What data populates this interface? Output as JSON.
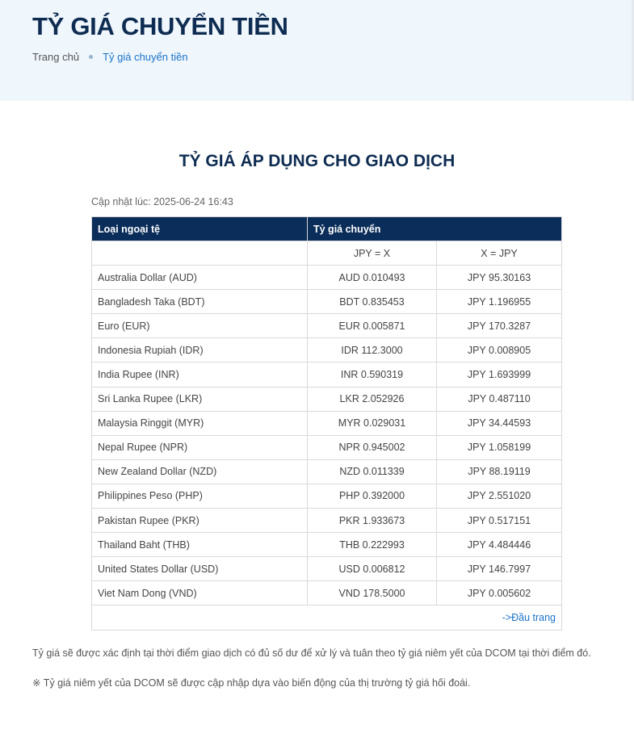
{
  "header": {
    "title": "TỶ GIÁ CHUYỂN TIỀN",
    "breadcrumb": {
      "home": "Trang chủ",
      "current": "Tỷ giá chuyển tiền"
    }
  },
  "main": {
    "section_title": "TỶ GIÁ ÁP DỤNG CHO GIAO DỊCH",
    "updated_text": "Cập nhật lúc: 2025-06-24 16:43",
    "table": {
      "header_currency": "Loại ngoại tệ",
      "header_rate": "Tỷ giá chuyển",
      "sub_header_left": "JPY = X",
      "sub_header_right": "X = JPY",
      "rows": [
        {
          "currency": "Australia Dollar (AUD)",
          "jpy_to_x": "AUD 0.010493",
          "x_to_jpy": "JPY 95.30163"
        },
        {
          "currency": "Bangladesh Taka (BDT)",
          "jpy_to_x": "BDT 0.835453",
          "x_to_jpy": "JPY 1.196955"
        },
        {
          "currency": "Euro (EUR)",
          "jpy_to_x": "EUR 0.005871",
          "x_to_jpy": "JPY 170.3287"
        },
        {
          "currency": "Indonesia Rupiah (IDR)",
          "jpy_to_x": "IDR 112.3000",
          "x_to_jpy": "JPY 0.008905"
        },
        {
          "currency": "India Rupee (INR)",
          "jpy_to_x": "INR 0.590319",
          "x_to_jpy": "JPY 1.693999"
        },
        {
          "currency": "Sri Lanka Rupee (LKR)",
          "jpy_to_x": "LKR 2.052926",
          "x_to_jpy": "JPY 0.487110"
        },
        {
          "currency": "Malaysia Ringgit (MYR)",
          "jpy_to_x": "MYR 0.029031",
          "x_to_jpy": "JPY 34.44593"
        },
        {
          "currency": "Nepal Rupee (NPR)",
          "jpy_to_x": "NPR 0.945002",
          "x_to_jpy": "JPY 1.058199"
        },
        {
          "currency": "New Zealand Dollar (NZD)",
          "jpy_to_x": "NZD 0.011339",
          "x_to_jpy": "JPY 88.19119"
        },
        {
          "currency": "Philippines Peso (PHP)",
          "jpy_to_x": "PHP 0.392000",
          "x_to_jpy": "JPY 2.551020"
        },
        {
          "currency": "Pakistan Rupee (PKR)",
          "jpy_to_x": "PKR 1.933673",
          "x_to_jpy": "JPY 0.517151"
        },
        {
          "currency": "Thailand Baht (THB)",
          "jpy_to_x": "THB 0.222993",
          "x_to_jpy": "JPY 4.484446"
        },
        {
          "currency": "United States Dollar (USD)",
          "jpy_to_x": "USD 0.006812",
          "x_to_jpy": "JPY 146.7997"
        },
        {
          "currency": "Viet Nam Dong (VND)",
          "jpy_to_x": "VND 178.5000",
          "x_to_jpy": "JPY 0.005602"
        }
      ],
      "back_to_top": "->Đầu trang"
    },
    "notes": [
      "Tỷ giá sẽ được xác định tại thời điểm giao dịch có đủ số dư để xử lý và tuân theo tỷ giá niêm yết của DCOM tại thời điểm đó.",
      "※ Tỷ giá niêm yết của DCOM sẽ được cập nhập dựa vào biến động của thị trường tỷ giá hối đoái."
    ]
  },
  "colors": {
    "navy": "#0a2d5a",
    "link": "#1c74c9",
    "band": "#eff6fc"
  }
}
